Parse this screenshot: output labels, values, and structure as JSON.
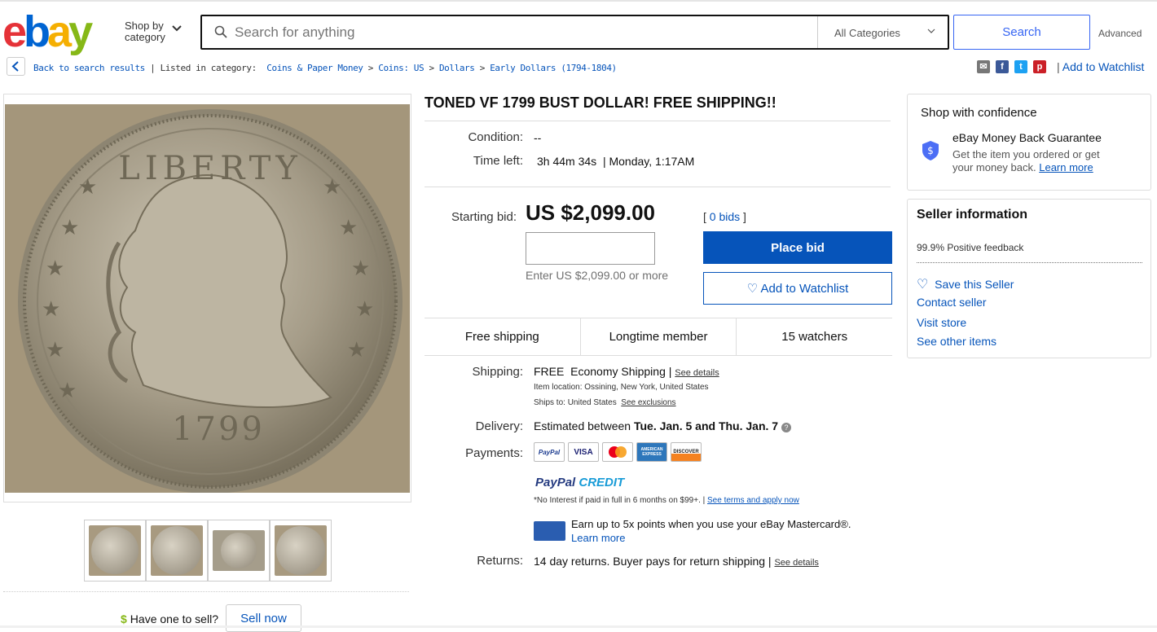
{
  "header": {
    "logo": {
      "e": "e",
      "b": "b",
      "a": "a",
      "y": "y"
    },
    "shop_by": "Shop by",
    "category": "category",
    "search_placeholder": "Search for anything",
    "category_select": "All Categories",
    "search_button": "Search",
    "advanced": "Advanced"
  },
  "breadcrumb": {
    "back": "Back to search results",
    "listed_in": "| Listed in category:",
    "items": [
      "Coins & Paper Money",
      "Coins: US",
      "Dollars",
      "Early Dollars (1794-1804)"
    ],
    "sep": ">"
  },
  "share": {
    "add_to_watchlist": "Add to Watchlist"
  },
  "listing": {
    "title": "TONED VF 1799 BUST DOLLAR! FREE SHIPPING!!",
    "coin_text": {
      "liberty": "LIBERTY",
      "year": "1799"
    },
    "condition_label": "Condition:",
    "condition_value": "--",
    "time_left_label": "Time left:",
    "time_left_value": "3h 44m 34s",
    "time_left_end": "| Monday, 1:17AM",
    "starting_bid_label": "Starting bid:",
    "price": "US $2,099.00",
    "bid_hint": "Enter US $2,099.00 or more",
    "bids_open": "[",
    "bids": "0 bids",
    "bids_close": "]",
    "place_bid": "Place bid",
    "add_watch": "Add to Watchlist",
    "stats": [
      "Free shipping",
      "Longtime member",
      "15 watchers"
    ],
    "shipping_label": "Shipping:",
    "shipping_free": "FREE",
    "shipping_method": "Economy Shipping |",
    "see_details": "See details",
    "item_location": "Item location:  Ossining, New York, United States",
    "ships_to": "Ships to:  United States",
    "see_exclusions": "See exclusions",
    "delivery_label": "Delivery:",
    "delivery_text": "Estimated between",
    "delivery_dates": "Tue. Jan. 5 and Thu. Jan. 7",
    "payments_label": "Payments:",
    "payment_methods": [
      "PayPal",
      "VISA",
      "Mastercard",
      "AMERICAN EXPRESS",
      "DISCOVER"
    ],
    "paypal_pay": "PayPal",
    "paypal_credit": "CREDIT",
    "credit_note": "*No Interest if paid in full in 6 months on $99+. |",
    "see_terms": "See terms and apply now",
    "mastercard_text": "Earn up to 5x points when you use your eBay Mastercard®.",
    "learn_more": "Learn more",
    "returns_label": "Returns:",
    "returns_text": "14 day returns. Buyer pays for return shipping |",
    "returns_details": "See details"
  },
  "sell": {
    "have_one": "Have one to sell?",
    "dollar": "$",
    "sell_now": "Sell now"
  },
  "confidence": {
    "title": "Shop with confidence",
    "guarantee": "eBay Money Back Guarantee",
    "desc1": "Get the item you ordered or get",
    "desc2": "your money back.",
    "learn_more": "Learn more"
  },
  "seller": {
    "title": "Seller information",
    "feedback": "99.9% Positive feedback",
    "save": "Save this Seller",
    "contact": "Contact seller",
    "visit": "Visit store",
    "other": "See other items"
  }
}
